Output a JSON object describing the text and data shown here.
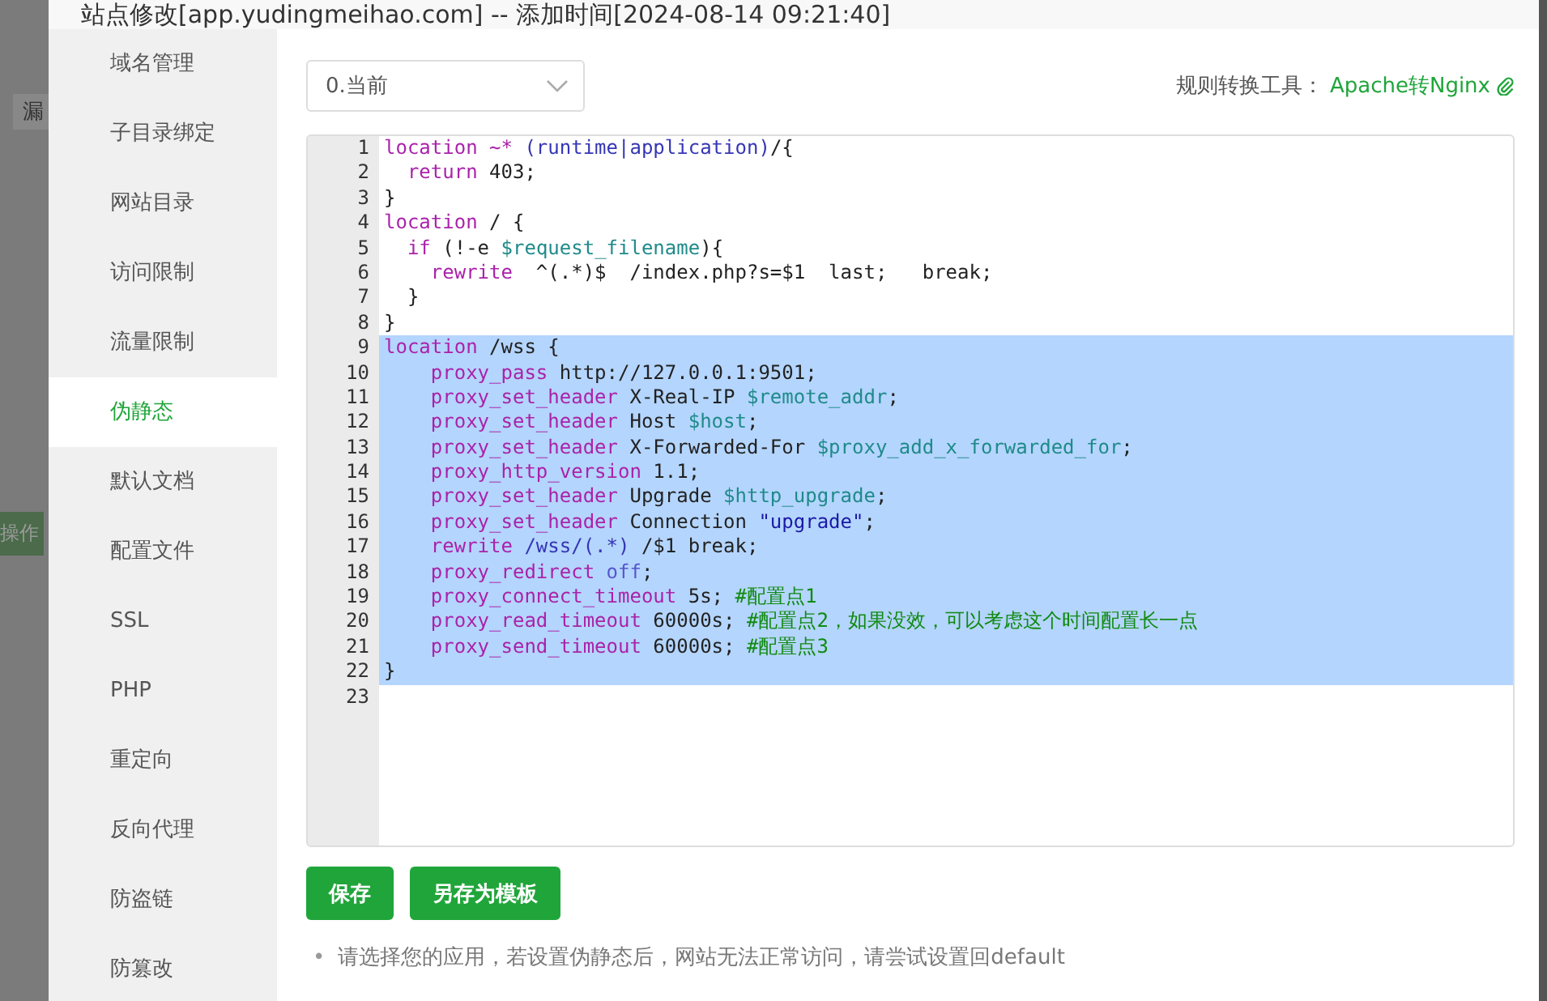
{
  "backdrop": {
    "fragments": [
      {
        "text": "漏",
        "kind": "tab"
      },
      {
        "text": "操作",
        "kind": "button"
      }
    ]
  },
  "window": {
    "title": "站点修改[app.yudingmeihao.com] -- 添加时间[2024-08-14 09:21:40]"
  },
  "sidebar": {
    "items": [
      {
        "label": "域名管理",
        "selected": false
      },
      {
        "label": "子目录绑定",
        "selected": false
      },
      {
        "label": "网站目录",
        "selected": false
      },
      {
        "label": "访问限制",
        "selected": false
      },
      {
        "label": "流量限制",
        "selected": false
      },
      {
        "label": "伪静态",
        "selected": true
      },
      {
        "label": "默认文档",
        "selected": false
      },
      {
        "label": "配置文件",
        "selected": false
      },
      {
        "label": "SSL",
        "selected": false
      },
      {
        "label": "PHP",
        "selected": false
      },
      {
        "label": "重定向",
        "selected": false
      },
      {
        "label": "反向代理",
        "selected": false
      },
      {
        "label": "防盗链",
        "selected": false
      },
      {
        "label": "防篡改",
        "selected": false
      }
    ]
  },
  "template_select": {
    "value": "0.当前"
  },
  "converter": {
    "label": "规则转换工具：",
    "link": "Apache转Nginx"
  },
  "editor": {
    "lines": [
      {
        "number": "1",
        "selected": false,
        "tokens": [
          {
            "kind": "keyword",
            "text": "location"
          },
          {
            "kind": "keyword",
            "text": " ~*"
          },
          {
            "kind": "regex",
            "text": " (runtime|application)"
          },
          {
            "kind": "plain",
            "text": "/{"
          }
        ]
      },
      {
        "number": "2",
        "selected": false,
        "tokens": [
          {
            "kind": "keyword",
            "text": "  return"
          },
          {
            "kind": "plain",
            "text": " 403;"
          }
        ]
      },
      {
        "number": "3",
        "selected": false,
        "tokens": [
          {
            "kind": "plain",
            "text": "}"
          }
        ]
      },
      {
        "number": "4",
        "selected": false,
        "tokens": [
          {
            "kind": "keyword",
            "text": "location"
          },
          {
            "kind": "plain",
            "text": " / {"
          }
        ]
      },
      {
        "number": "5",
        "selected": false,
        "tokens": [
          {
            "kind": "keyword",
            "text": "  if"
          },
          {
            "kind": "plain",
            "text": " (!-e "
          },
          {
            "kind": "variable",
            "text": "$request_filename"
          },
          {
            "kind": "plain",
            "text": "){"
          }
        ]
      },
      {
        "number": "6",
        "selected": false,
        "tokens": [
          {
            "kind": "keyword",
            "text": "    rewrite"
          },
          {
            "kind": "plain",
            "text": "  ^(.*)$  /index.php?s=$1  last;   break;"
          }
        ]
      },
      {
        "number": "7",
        "selected": false,
        "tokens": [
          {
            "kind": "plain",
            "text": "  }"
          }
        ]
      },
      {
        "number": "8",
        "selected": false,
        "tokens": [
          {
            "kind": "plain",
            "text": "}"
          }
        ]
      },
      {
        "number": "9",
        "selected": true,
        "tokens": [
          {
            "kind": "keyword",
            "text": "location"
          },
          {
            "kind": "plain",
            "text": " /wss {"
          }
        ]
      },
      {
        "number": "10",
        "selected": true,
        "tokens": [
          {
            "kind": "keyword",
            "text": "    proxy_pass"
          },
          {
            "kind": "plain",
            "text": " http://127.0.0.1:9501;"
          }
        ]
      },
      {
        "number": "11",
        "selected": true,
        "tokens": [
          {
            "kind": "keyword",
            "text": "    proxy_set_header"
          },
          {
            "kind": "plain",
            "text": " X-Real-IP "
          },
          {
            "kind": "variable",
            "text": "$remote_addr"
          },
          {
            "kind": "plain",
            "text": ";"
          }
        ]
      },
      {
        "number": "12",
        "selected": true,
        "tokens": [
          {
            "kind": "keyword",
            "text": "    proxy_set_header"
          },
          {
            "kind": "plain",
            "text": " Host "
          },
          {
            "kind": "variable",
            "text": "$host"
          },
          {
            "kind": "plain",
            "text": ";"
          }
        ]
      },
      {
        "number": "13",
        "selected": true,
        "tokens": [
          {
            "kind": "keyword",
            "text": "    proxy_set_header"
          },
          {
            "kind": "plain",
            "text": " X-Forwarded-For "
          },
          {
            "kind": "variable",
            "text": "$proxy_add_x_forwarded_for"
          },
          {
            "kind": "plain",
            "text": ";"
          }
        ]
      },
      {
        "number": "14",
        "selected": true,
        "tokens": [
          {
            "kind": "keyword",
            "text": "    proxy_http_version"
          },
          {
            "kind": "plain",
            "text": " 1.1;"
          }
        ]
      },
      {
        "number": "15",
        "selected": true,
        "tokens": [
          {
            "kind": "keyword",
            "text": "    proxy_set_header"
          },
          {
            "kind": "plain",
            "text": " Upgrade "
          },
          {
            "kind": "variable",
            "text": "$http_upgrade"
          },
          {
            "kind": "plain",
            "text": ";"
          }
        ]
      },
      {
        "number": "16",
        "selected": true,
        "tokens": [
          {
            "kind": "keyword",
            "text": "    proxy_set_header"
          },
          {
            "kind": "plain",
            "text": " Connection "
          },
          {
            "kind": "string",
            "text": "\"upgrade\""
          },
          {
            "kind": "plain",
            "text": ";"
          }
        ]
      },
      {
        "number": "17",
        "selected": true,
        "tokens": [
          {
            "kind": "keyword",
            "text": "    rewrite"
          },
          {
            "kind": "regex",
            "text": " /wss/(.*)"
          },
          {
            "kind": "plain",
            "text": " /$1 break;"
          }
        ]
      },
      {
        "number": "18",
        "selected": true,
        "tokens": [
          {
            "kind": "keyword",
            "text": "    proxy_redirect"
          },
          {
            "kind": "atom",
            "text": " off"
          },
          {
            "kind": "plain",
            "text": ";"
          }
        ]
      },
      {
        "number": "19",
        "selected": true,
        "tokens": [
          {
            "kind": "keyword",
            "text": "    proxy_connect_timeout"
          },
          {
            "kind": "plain",
            "text": " 5s; "
          },
          {
            "kind": "comment",
            "text": "#配置点1"
          }
        ]
      },
      {
        "number": "20",
        "selected": true,
        "tokens": [
          {
            "kind": "keyword",
            "text": "    proxy_read_timeout"
          },
          {
            "kind": "plain",
            "text": " 60000s; "
          },
          {
            "kind": "comment",
            "text": "#配置点2，如果没效，可以考虑这个时间配置长一点"
          }
        ]
      },
      {
        "number": "21",
        "selected": true,
        "tokens": [
          {
            "kind": "keyword",
            "text": "    proxy_send_timeout"
          },
          {
            "kind": "plain",
            "text": " 60000s; "
          },
          {
            "kind": "comment",
            "text": "#配置点3"
          }
        ]
      },
      {
        "number": "22",
        "selected": true,
        "tokens": [
          {
            "kind": "plain",
            "text": "}"
          }
        ]
      },
      {
        "number": "23",
        "selected": false
      }
    ]
  },
  "buttons": [
    "保存",
    "另存为模板"
  ],
  "notes": [
    {
      "bullet": "•",
      "text": "请选择您的应用，若设置伪静态后，网站无法正常访问，请尝试设置回default"
    }
  ]
}
